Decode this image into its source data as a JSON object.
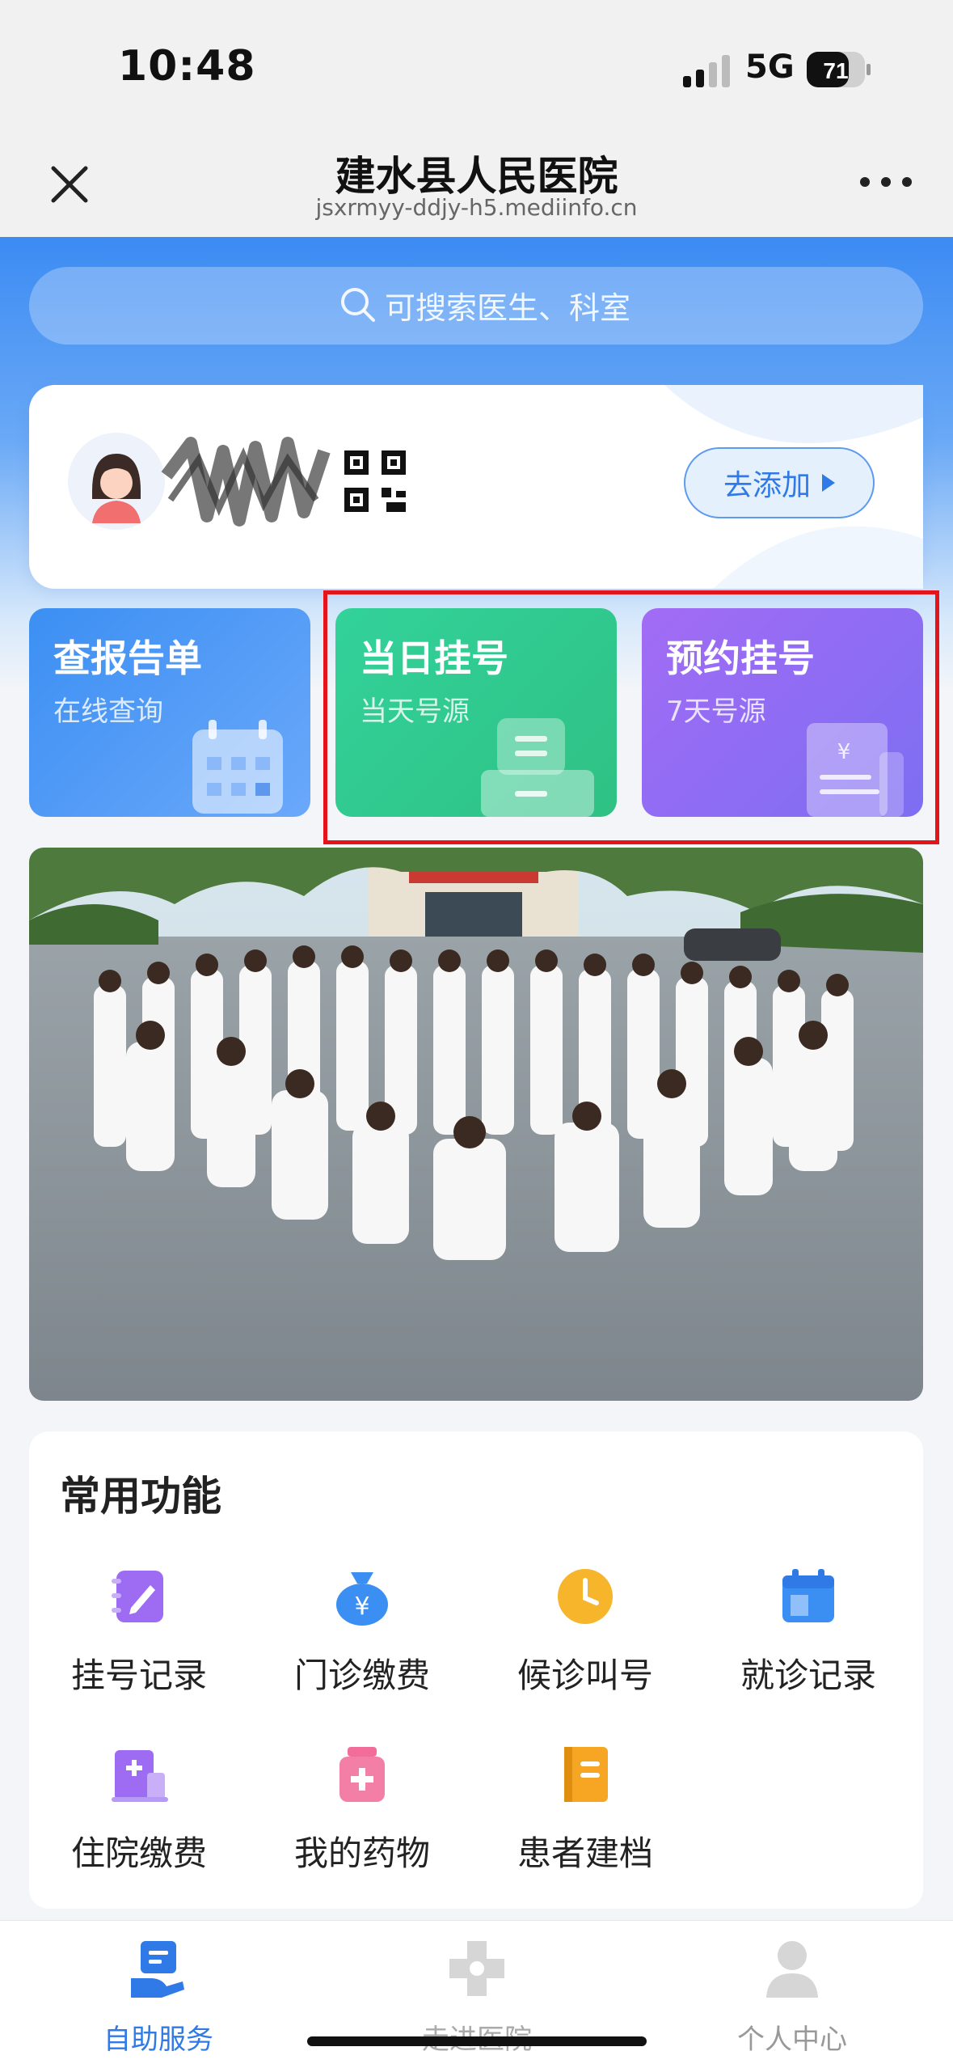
{
  "status_bar": {
    "time": "10:48",
    "network": "5G",
    "battery": "71"
  },
  "nav": {
    "title": "建水县人民医院",
    "url": "jsxrmyy-ddjy-h5.mediinfo.cn"
  },
  "search": {
    "placeholder": "可搜索医生、科室"
  },
  "patient_card": {
    "add_label": "去添加"
  },
  "tiles": [
    {
      "title": "查报告单",
      "subtitle": "在线查询",
      "color": "#4a95f5"
    },
    {
      "title": "当日挂号",
      "subtitle": "当天号源",
      "color": "#30c98e"
    },
    {
      "title": "预约挂号",
      "subtitle": "7天号源",
      "color": "#8f6cf4"
    }
  ],
  "functions": {
    "title": "常用功能",
    "items": [
      {
        "label": "挂号记录",
        "icon": "edit-notes-icon"
      },
      {
        "label": "门诊缴费",
        "icon": "money-bag-icon"
      },
      {
        "label": "候诊叫号",
        "icon": "clock-icon"
      },
      {
        "label": "就诊记录",
        "icon": "calendar-icon"
      },
      {
        "label": "住院缴费",
        "icon": "hospital-building-icon"
      },
      {
        "label": "我的药物",
        "icon": "medicine-bottle-icon"
      },
      {
        "label": "患者建档",
        "icon": "book-icon"
      }
    ]
  },
  "tabbar": {
    "items": [
      {
        "label": "自助服务",
        "active": true
      },
      {
        "label": "走进医院",
        "active": false
      },
      {
        "label": "个人中心",
        "active": false
      }
    ]
  },
  "colors": {
    "primary": "#3c8bf3",
    "highlight_box": "#e5141b"
  }
}
